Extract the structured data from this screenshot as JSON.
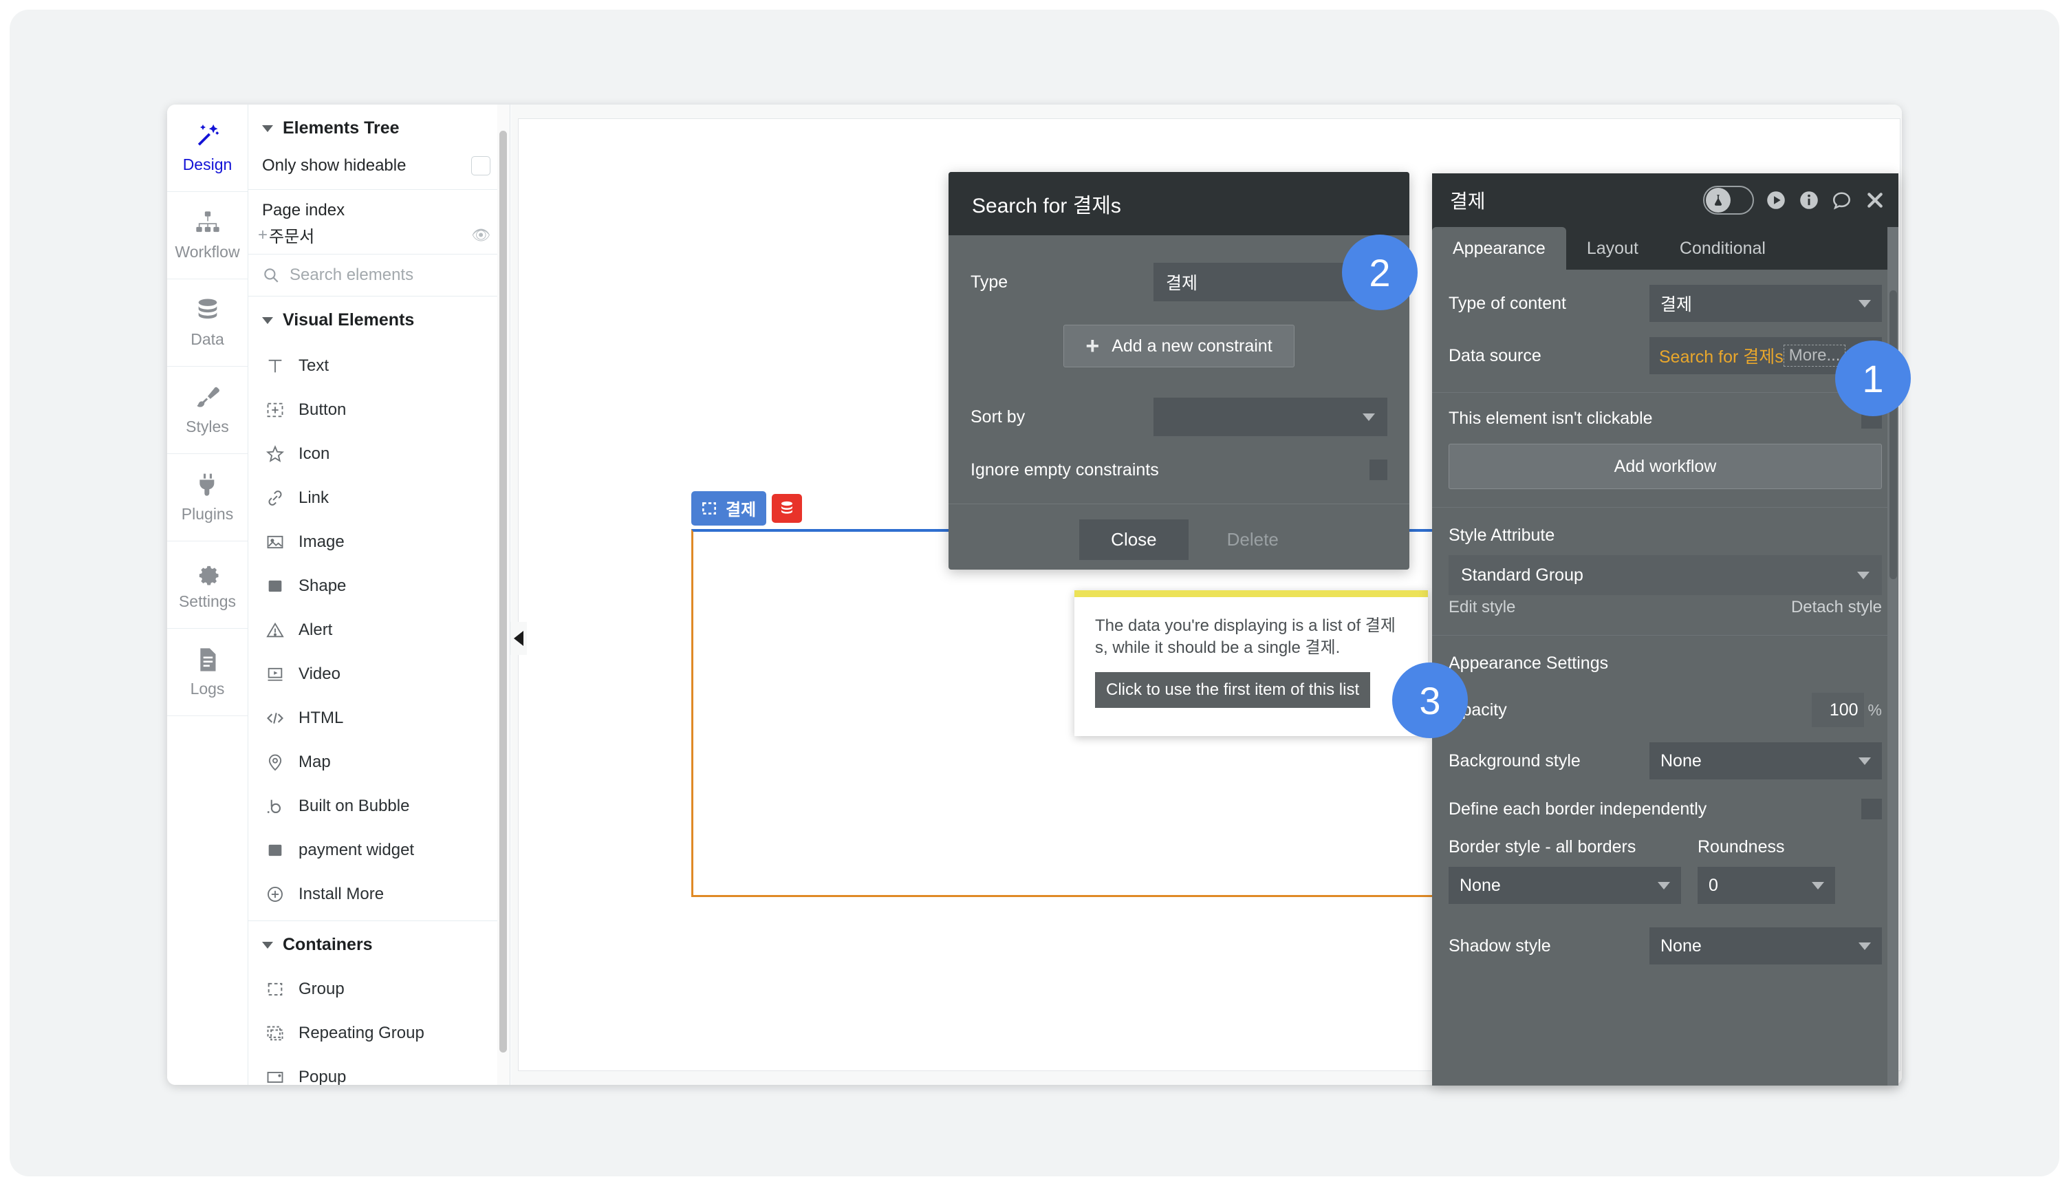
{
  "rail": {
    "items": [
      {
        "label": "Design",
        "icon": "magic-wand-icon",
        "active": true
      },
      {
        "label": "Workflow",
        "icon": "sitemap-icon",
        "active": false
      },
      {
        "label": "Data",
        "icon": "database-icon",
        "active": false
      },
      {
        "label": "Styles",
        "icon": "paintbrush-icon",
        "active": false
      },
      {
        "label": "Plugins",
        "icon": "plug-icon",
        "active": false
      },
      {
        "label": "Settings",
        "icon": "gear-icon",
        "active": false
      },
      {
        "label": "Logs",
        "icon": "document-icon",
        "active": false
      }
    ]
  },
  "tree": {
    "section_title": "Elements Tree",
    "only_show_hideable": "Only show hideable",
    "page_index_label": "Page index",
    "page_node": "주문서",
    "search_placeholder": "Search elements",
    "search_value": "",
    "visual_elements_title": "Visual Elements",
    "visual_elements": [
      {
        "label": "Text",
        "icon": "text-icon"
      },
      {
        "label": "Button",
        "icon": "button-icon"
      },
      {
        "label": "Icon",
        "icon": "star-icon"
      },
      {
        "label": "Link",
        "icon": "link-icon"
      },
      {
        "label": "Image",
        "icon": "image-icon"
      },
      {
        "label": "Shape",
        "icon": "shape-icon"
      },
      {
        "label": "Alert",
        "icon": "alert-icon"
      },
      {
        "label": "Video",
        "icon": "video-icon"
      },
      {
        "label": "HTML",
        "icon": "code-icon"
      },
      {
        "label": "Map",
        "icon": "map-pin-icon"
      },
      {
        "label": "Built on Bubble",
        "icon": "bubble-logo-icon"
      },
      {
        "label": "payment widget",
        "icon": "shape-icon"
      },
      {
        "label": "Install More",
        "icon": "plus-circle-icon"
      }
    ],
    "containers_title": "Containers",
    "containers": [
      {
        "label": "Group",
        "icon": "group-icon"
      },
      {
        "label": "Repeating Group",
        "icon": "repeating-group-icon"
      },
      {
        "label": "Popup",
        "icon": "popup-icon"
      }
    ]
  },
  "canvas": {
    "group_label": "결제",
    "group_icon": "group-icon",
    "data_badge_icon": "database-icon"
  },
  "modal": {
    "title": "Search for 결제s",
    "type_label": "Type",
    "type_value": "결제",
    "add_constraint_label": "Add a new constraint",
    "sort_by_label": "Sort by",
    "sort_by_value": "",
    "ignore_empty_label": "Ignore empty constraints",
    "close_label": "Close",
    "delete_label": "Delete"
  },
  "warning": {
    "message": "The data you're displaying is a list of 결제s, while it should be a single 결제.",
    "action_label": "Click to use the first item of this list"
  },
  "props": {
    "title": "결제",
    "header_icons": [
      {
        "name": "flask-toggle-icon"
      },
      {
        "name": "preview-play-icon"
      },
      {
        "name": "info-icon"
      },
      {
        "name": "comment-icon"
      },
      {
        "name": "close-icon"
      }
    ],
    "tabs": [
      {
        "label": "Appearance",
        "active": true
      },
      {
        "label": "Layout",
        "active": false
      },
      {
        "label": "Conditional",
        "active": false
      }
    ],
    "type_of_content_label": "Type of content",
    "type_of_content_value": "결제",
    "data_source_label": "Data source",
    "data_source_value": "Search for 결제s",
    "data_source_more": "More...",
    "not_clickable_label": "This element isn't clickable",
    "add_workflow_label": "Add workflow",
    "style_attribute_label": "Style Attribute",
    "style_value": "Standard Group",
    "edit_style_label": "Edit style",
    "detach_style_label": "Detach style",
    "appearance_settings_label": "Appearance Settings",
    "opacity_label": "Opacity",
    "opacity_value": "100",
    "opacity_unit": "%",
    "background_style_label": "Background style",
    "background_style_value": "None",
    "define_borders_label": "Define each border independently",
    "border_style_label": "Border style - all borders",
    "border_style_value": "None",
    "roundness_label": "Roundness",
    "roundness_value": "0",
    "shadow_style_label": "Shadow style",
    "shadow_style_value": "None"
  },
  "badges": {
    "one": "1",
    "two": "2",
    "three": "3",
    "color": "#4a86e8"
  }
}
